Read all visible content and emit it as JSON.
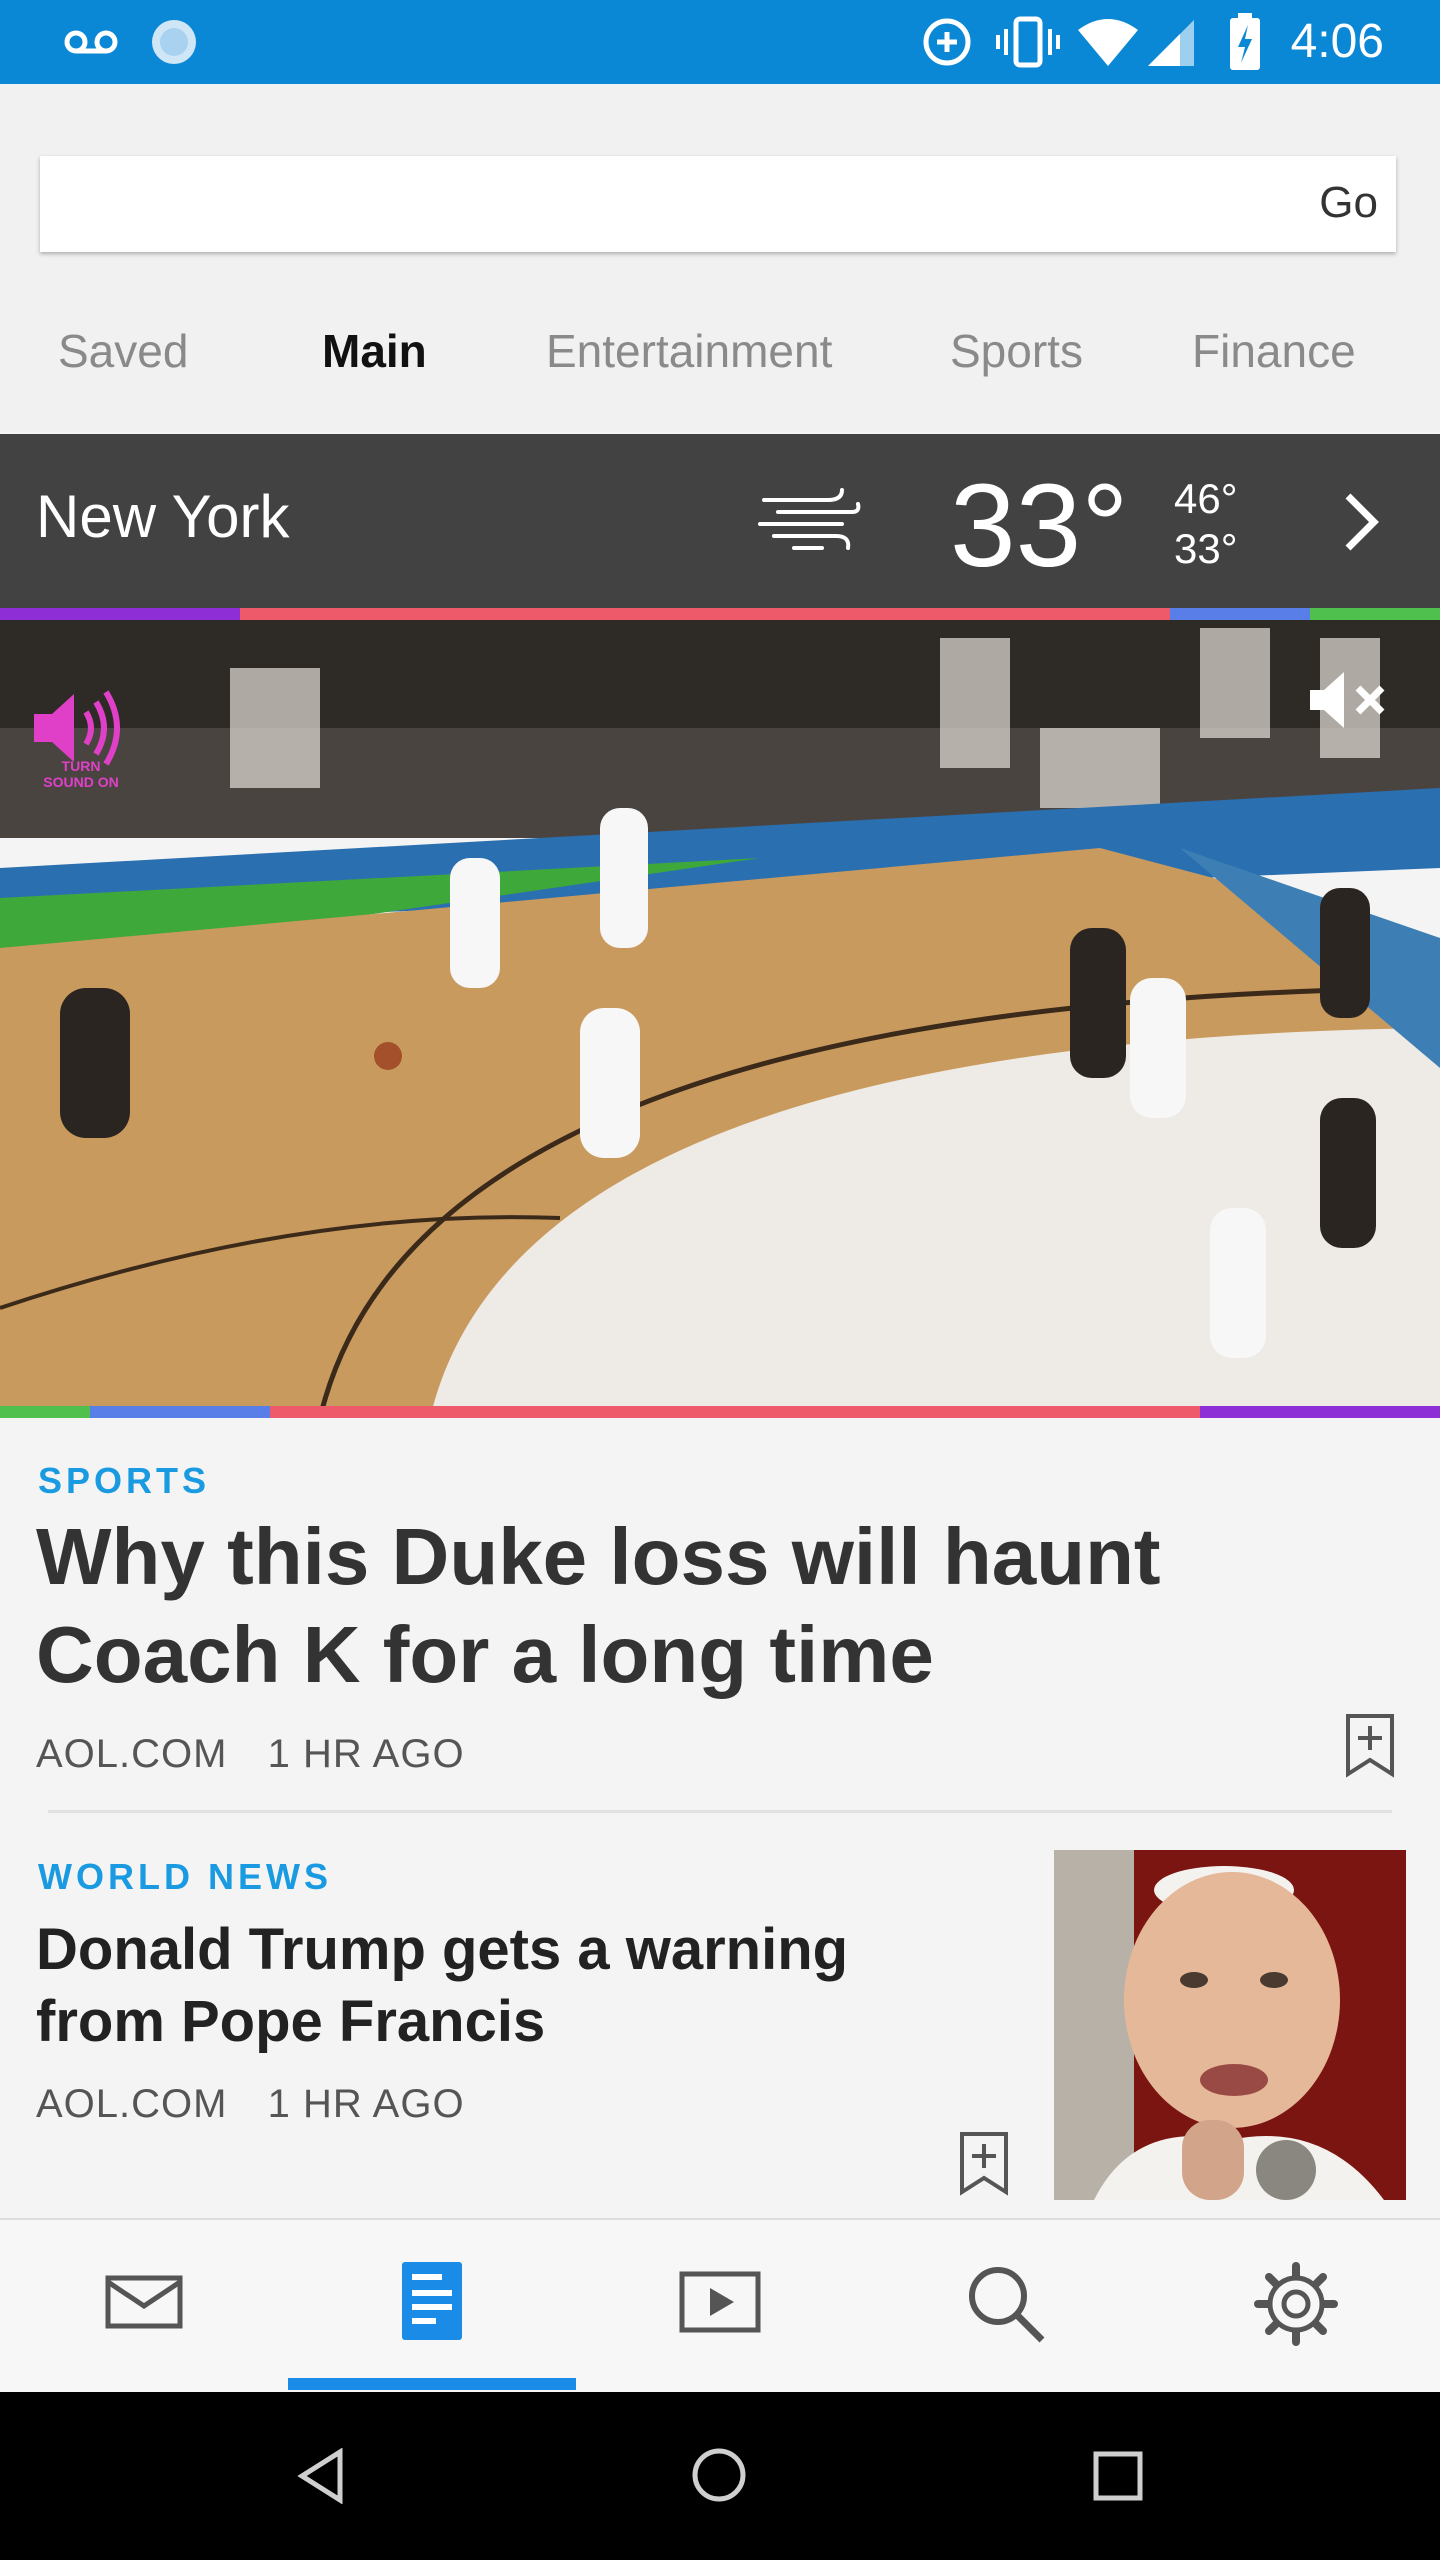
{
  "status_bar": {
    "time": "4:06",
    "left_icons": [
      "voicemail-icon",
      "sync-icon"
    ],
    "right_icons": [
      "data-saver-icon",
      "vibrate-icon",
      "wifi-icon",
      "signal-icon",
      "battery-charging-icon"
    ],
    "color": "#0a88d6"
  },
  "search": {
    "value": "",
    "placeholder": "",
    "go_label": "Go"
  },
  "tabs": [
    {
      "label": "Saved",
      "active": false
    },
    {
      "label": "Main",
      "active": true
    },
    {
      "label": "Entertainment",
      "active": false
    },
    {
      "label": "Sports",
      "active": false
    },
    {
      "label": "Finance",
      "active": false
    }
  ],
  "weather": {
    "city": "New York",
    "condition_icon": "wind-icon",
    "temperature": "33°",
    "high": "46°",
    "low": "33°"
  },
  "video": {
    "sound_on_label": "TURN SOUND ON",
    "mute_icon": "volume-off-icon"
  },
  "articles": [
    {
      "category": "SPORTS",
      "headline_line1": "Why this Duke loss will haunt",
      "headline_line2": "Coach K for a long time",
      "source": "AOL.COM",
      "age": "1 HR AGO"
    },
    {
      "category": "WORLD NEWS",
      "headline_line1": "Donald Trump gets a warning",
      "headline_line2": "from Pope Francis",
      "source": "AOL.COM",
      "age": "1 HR AGO"
    }
  ],
  "bottom_nav": [
    {
      "icon": "mail-icon",
      "active": false
    },
    {
      "icon": "news-icon",
      "active": true
    },
    {
      "icon": "video-icon",
      "active": false
    },
    {
      "icon": "search-icon",
      "active": false
    },
    {
      "icon": "gear-icon",
      "active": false
    }
  ],
  "colors": {
    "accent": "#1b8be8",
    "category": "#1a9ae0",
    "weather_bg": "#424242"
  }
}
